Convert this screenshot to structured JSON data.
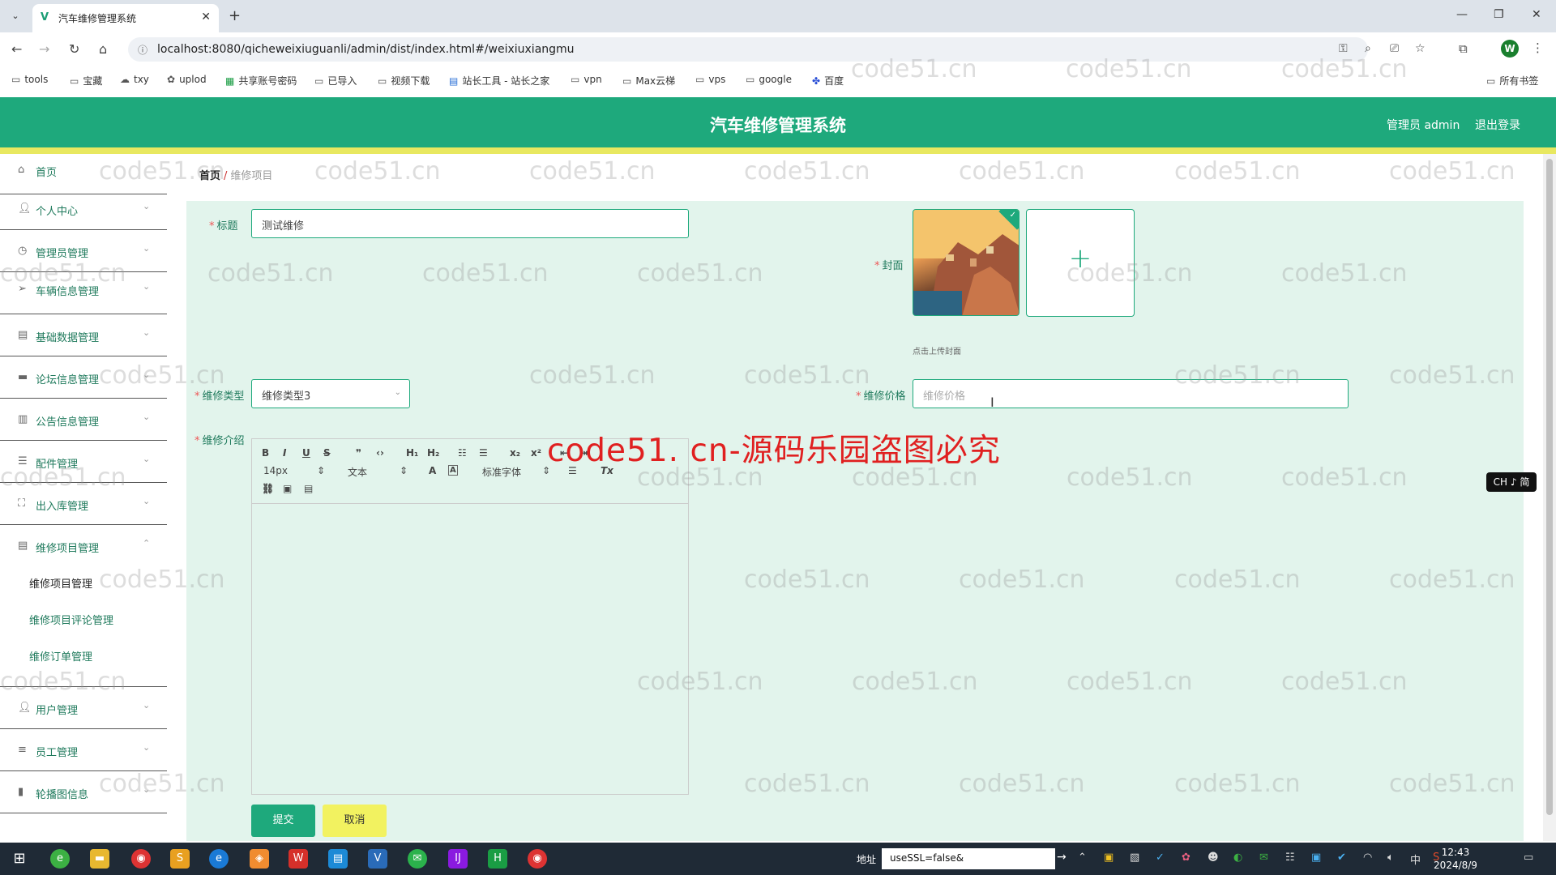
{
  "browser": {
    "tab_title": "汽车维修管理系统",
    "url": "localhost:8080/qicheweixiuguanli/admin/dist/index.html#/weixiuxiangmu",
    "profile_initial": "W",
    "bookmarks": [
      "tools",
      "宝藏",
      "txy",
      "uplod",
      "共享账号密码",
      "已导入",
      "视频下载",
      "站长工具 - 站长之家",
      "vpn",
      "Max云梯",
      "vps",
      "google",
      "百度"
    ],
    "all_bookmarks": "所有书签"
  },
  "header": {
    "title": "汽车维修管理系统",
    "admin": "管理员 admin",
    "logout": "退出登录"
  },
  "sidebar": {
    "items": [
      {
        "label": "首页",
        "icon": "home-icon"
      },
      {
        "label": "个人中心",
        "icon": "user-icon"
      },
      {
        "label": "管理员管理",
        "icon": "clock-icon"
      },
      {
        "label": "车辆信息管理",
        "icon": "send-icon"
      },
      {
        "label": "基础数据管理",
        "icon": "box-icon"
      },
      {
        "label": "论坛信息管理",
        "icon": "chat-icon"
      },
      {
        "label": "公告信息管理",
        "icon": "clipboard-icon"
      },
      {
        "label": "配件管理",
        "icon": "sliders-icon"
      },
      {
        "label": "出入库管理",
        "icon": "expand-icon"
      },
      {
        "label": "维修项目管理",
        "icon": "box-icon"
      },
      {
        "label": "用户管理",
        "icon": "user-icon"
      },
      {
        "label": "员工管理",
        "icon": "list-icon"
      },
      {
        "label": "轮播图信息",
        "icon": "bar-chart-icon"
      }
    ],
    "sub_items": [
      "维修项目管理",
      "维修项目评论管理",
      "维修订单管理"
    ]
  },
  "breadcrumb": {
    "home": "首页",
    "separator": "/",
    "current": "维修项目"
  },
  "form": {
    "title_label": "标题",
    "title_value": "测试维修",
    "cover_label": "封面",
    "cover_tip": "点击上传封面",
    "type_label": "维修类型",
    "type_value": "维修类型3",
    "price_label": "维修价格",
    "price_placeholder": "维修价格",
    "intro_label": "维修介绍",
    "editor_font_size": "14px",
    "editor_block": "文本",
    "editor_font": "标准字体",
    "submit": "提交",
    "cancel": "取消"
  },
  "watermark": {
    "small": "code51.cn",
    "big": "code51. cn-源码乐园盗图必究"
  },
  "ime": "CH ♪ 简",
  "taskbar": {
    "addr_label": "地址",
    "addr_value": "useSSL=false&",
    "time": "12:43",
    "date": "2024/8/9"
  },
  "colors": {
    "primary": "#1ea97c",
    "accent_yellow": "#e8e860",
    "panel": "#e2f4ec"
  }
}
